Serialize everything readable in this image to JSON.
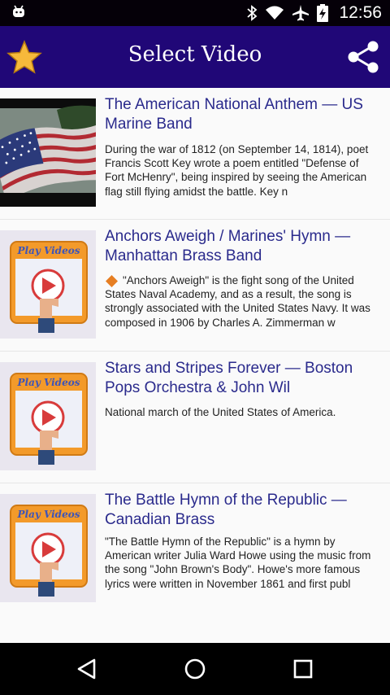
{
  "status_bar": {
    "time": "12:56"
  },
  "app_bar": {
    "title": "Select Video"
  },
  "icons": {
    "star": "star-icon",
    "share": "share-icon"
  },
  "videos": [
    {
      "title": "The American National Anthem — US Marine Band",
      "description": "During the war of 1812 (on September 14, 1814), poet Francis Scott Key wrote a poem entitled \"Defense of Fort McHenry\", being inspired by seeing the American flag still flying amidst the battle. Key n",
      "thumbnail": "american-flag"
    },
    {
      "title": "Anchors Aweigh / Marines' Hymn — Manhattan Brass Band",
      "description": "\"Anchors Aweigh\" is the fight song of the United States Naval Academy, and as a result, the song is strongly associated with the United States Navy. It was composed in 1906 by Charles A. Zimmerman w",
      "thumbnail": "play-videos"
    },
    {
      "title": "Stars and Stripes Forever — Boston Pops Orchestra & John Wil",
      "description": "National march of the United States of America.",
      "thumbnail": "play-videos"
    },
    {
      "title": "The Battle Hymn of the Republic — Canadian Brass",
      "description": "\"The Battle Hymn of the Republic\" is a hymn by American writer Julia Ward Howe using the music from the song \"John Brown's Body\". Howe's more famous lyrics were written in November 1861 and first publ",
      "thumbnail": "play-videos",
      "thumbnail_label": "Play Videos"
    }
  ],
  "play_videos_label": "Play Videos",
  "colors": {
    "app_bar": "#200777",
    "title_text": "#2a2a8c",
    "status_bar": "#050008",
    "accent_orange": "#f39a2a"
  }
}
